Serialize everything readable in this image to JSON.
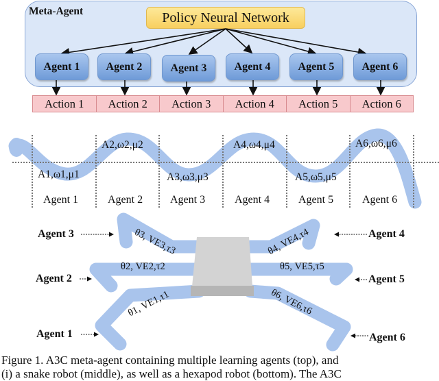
{
  "meta_agent": {
    "title": "Meta-Agent",
    "policy_network_label": "Policy Neural Network",
    "agents": [
      "Agent 1",
      "Agent 2",
      "Agent 3",
      "Agent 4",
      "Agent 5",
      "Agent 6"
    ],
    "actions": [
      "Action 1",
      "Action 2",
      "Action 3",
      "Action 4",
      "Action 5",
      "Action 6"
    ],
    "colors": {
      "container": "#dbe7f8",
      "policy": "#f8cf5f",
      "agent": "#6f9bd8",
      "action": "#f8c9cc"
    }
  },
  "snake_robot": {
    "segment_labels": [
      "A1,ω1,μ1",
      "A2,ω2,μ2",
      "A3,ω3,μ3",
      "A4,ω4,μ4",
      "A5,ω5,μ5",
      "A6,ω6,μ6"
    ],
    "agents": [
      "Agent 1",
      "Agent 2",
      "Agent 3",
      "Agent 4",
      "Agent 5",
      "Agent 6"
    ],
    "body_color": "#a9c4ec"
  },
  "hexapod_robot": {
    "legs": [
      {
        "agent": "Agent 1",
        "label": "θ1, VE1,τ1"
      },
      {
        "agent": "Agent 2",
        "label": "θ2, VE2,τ2"
      },
      {
        "agent": "Agent 3",
        "label": "θ3, VE3,τ3"
      },
      {
        "agent": "Agent 4",
        "label": "θ4, VE4,τ4"
      },
      {
        "agent": "Agent 5",
        "label": "θ5, VE5,τ5"
      },
      {
        "agent": "Agent 6",
        "label": "θ6, VE6,τ6"
      }
    ],
    "leg_color": "#a9c4ec",
    "body_color": "#cfcfcf"
  },
  "caption": {
    "line1": "Figure 1.   A3C meta-agent containing multiple learning agents (top), and",
    "line2": "(i) a snake robot (middle), as well as a hexapod robot (bottom). The A3C"
  }
}
